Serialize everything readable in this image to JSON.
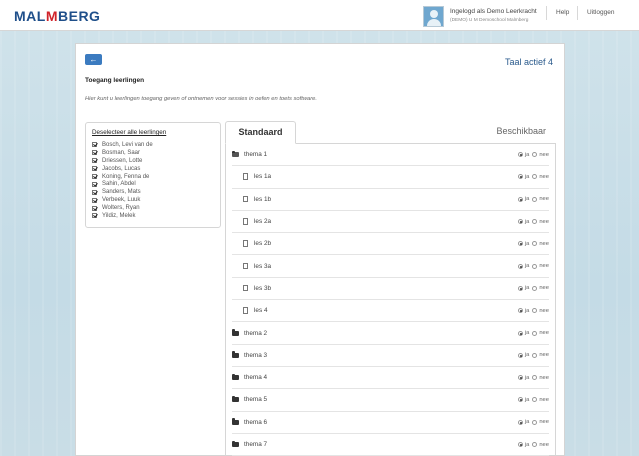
{
  "header": {
    "logo_left": "MAL",
    "logo_mid": "M",
    "logo_right": "BERG",
    "user_name": "Ingelogd als Demo Leerkracht",
    "school": "(DEMO) U M Demoschool Malmberg",
    "help": "Help",
    "logout": "Uitloggen"
  },
  "panel": {
    "back_icon": "←",
    "language": "Taal actief 4",
    "title": "Toegang leerlingen",
    "intro": "Hier kunt u leerlingen toegang geven of ontnemen voor sessies in oefen en toets software."
  },
  "students": {
    "deselect_all": "Deselecteer alle leerlingen",
    "list": [
      "Bosch, Levi van de",
      "Bosman, Saar",
      "Driessen, Lotte",
      "Jacobs, Lucas",
      "Koning, Fenna de",
      "Sahin, Abdel",
      "Sanders, Mats",
      "Verbeek, Luuk",
      "Wolters, Ryan",
      "Yildiz, Melek"
    ]
  },
  "tabs": {
    "standard": "Standaard",
    "available": "Beschikbaar"
  },
  "radio_labels": {
    "yes": "ja",
    "no": "nee"
  },
  "tree": [
    {
      "label": "thema 1",
      "type": "folder-open",
      "level": 0,
      "value": "ja"
    },
    {
      "label": "les 1a",
      "type": "file",
      "level": 1,
      "value": "ja"
    },
    {
      "label": "les 1b",
      "type": "file",
      "level": 1,
      "value": "ja"
    },
    {
      "label": "les 2a",
      "type": "file",
      "level": 1,
      "value": "ja"
    },
    {
      "label": "les 2b",
      "type": "file",
      "level": 1,
      "value": "ja"
    },
    {
      "label": "les 3a",
      "type": "file",
      "level": 1,
      "value": "ja"
    },
    {
      "label": "les 3b",
      "type": "file",
      "level": 1,
      "value": "ja"
    },
    {
      "label": "les 4",
      "type": "file",
      "level": 1,
      "value": "ja"
    },
    {
      "label": "thema 2",
      "type": "folder",
      "level": 0,
      "value": "ja"
    },
    {
      "label": "thema 3",
      "type": "folder",
      "level": 0,
      "value": "ja"
    },
    {
      "label": "thema 4",
      "type": "folder",
      "level": 0,
      "value": "ja"
    },
    {
      "label": "thema 5",
      "type": "folder",
      "level": 0,
      "value": "ja"
    },
    {
      "label": "thema 6",
      "type": "folder",
      "level": 0,
      "value": "ja"
    },
    {
      "label": "thema 7",
      "type": "folder",
      "level": 0,
      "value": "ja"
    }
  ]
}
